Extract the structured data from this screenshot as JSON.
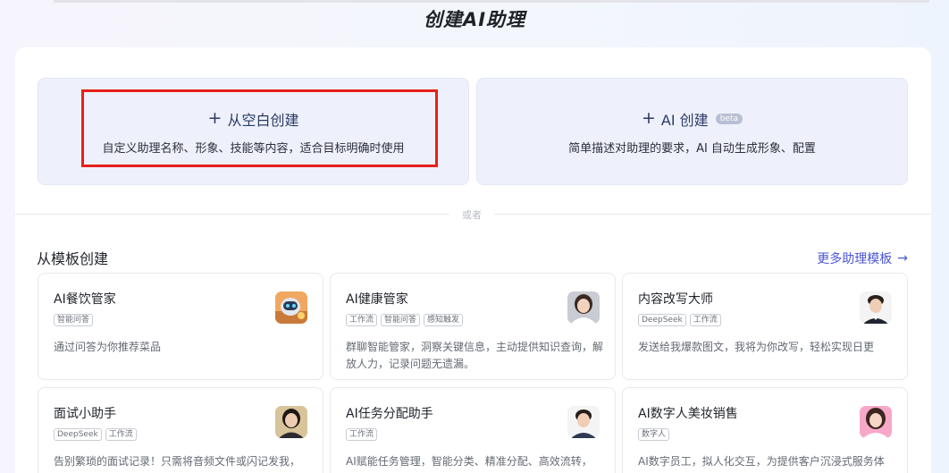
{
  "page": {
    "title": "创建AI助理"
  },
  "create_options": {
    "blank": {
      "title": "从空白创建",
      "desc": "自定义助理名称、形象、技能等内容，适合目标明确时使用"
    },
    "ai": {
      "title": "AI 创建",
      "badge": "beta",
      "desc": "简单描述对助理的要求，AI 自动生成形象、配置"
    }
  },
  "divider": {
    "text": "或者"
  },
  "templates": {
    "section_title": "从模板创建",
    "more_link": "更多助理模板",
    "items": [
      {
        "name": "AI餐饮管家",
        "tags": [
          "智能问答"
        ],
        "desc": "通过问答为你推荐菜品"
      },
      {
        "name": "AI健康管家",
        "tags": [
          "工作流",
          "智能问答",
          "感知触发"
        ],
        "desc": "群聊智能管家，洞察关键信息，主动提供知识查询，解放人力，记录问题无遗漏。"
      },
      {
        "name": "内容改写大师",
        "tags": [
          "DeepSeek",
          "工作流"
        ],
        "desc": "发送给我爆款图文，我将为你改写，轻松实现日更"
      },
      {
        "name": "面试小助手",
        "tags": [
          "DeepSeek",
          "工作流"
        ],
        "desc": "告别繁琐的面试记录！只需将音频文件或闪记发我，"
      },
      {
        "name": "AI任务分配助手",
        "tags": [
          "工作流"
        ],
        "desc": "AI赋能任务管理，智能分类、精准分配、高效流转，"
      },
      {
        "name": "AI数字人美妆销售",
        "tags": [
          "数字人"
        ],
        "desc": "AI数字员工，拟人化交互，为提供客户沉浸式服务体"
      }
    ]
  },
  "colors": {
    "accent": "#4a56d4",
    "highlight": "#e8201b",
    "card_bg": "#eef1fb"
  }
}
